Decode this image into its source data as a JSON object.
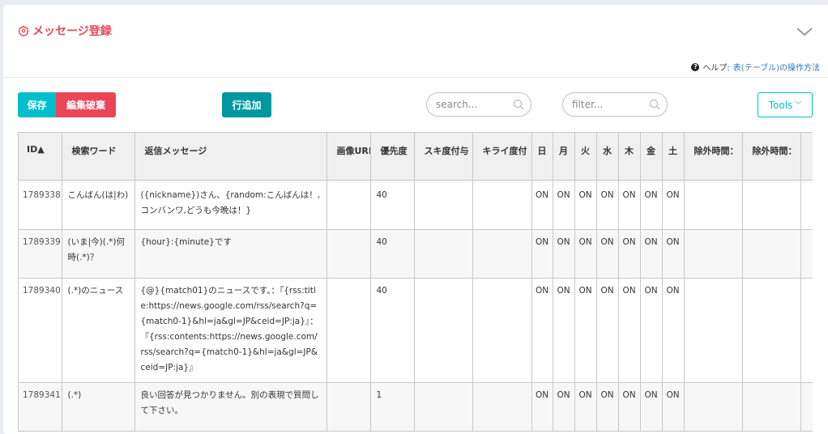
{
  "header": {
    "title": "メッセージ登録",
    "title_icon": "gear-icon",
    "collapse_icon": "chevron-down-icon",
    "help_label": "ヘルプ:",
    "help_link": "表(テーブル)の操作方法"
  },
  "toolbar": {
    "save": "保存",
    "discard": "編集破棄",
    "add_row": "行追加",
    "search_placeholder": "search...",
    "filter_placeholder": "filter...",
    "tools": "Tools"
  },
  "colors": {
    "accent": "#00bfcc",
    "danger": "#ea4658",
    "title": "#e8485a",
    "add": "#00979e"
  },
  "table": {
    "columns": [
      "ID▲",
      "検索ワード",
      "返信メッセージ",
      "画像URL",
      "優先度",
      "スキ度付与",
      "キライ度付",
      "日",
      "月",
      "火",
      "水",
      "木",
      "金",
      "土",
      "除外時間：",
      "除外時間：",
      ""
    ],
    "rows": [
      {
        "id": "1789338",
        "word": "こんばん(は|わ)",
        "reply": "({nickname})さん、{random:こんばんは！,コンバンワ,どうも今晩は！}",
        "image": "",
        "priority": "40",
        "like": "",
        "dislike": "",
        "days": [
          "ON",
          "ON",
          "ON",
          "ON",
          "ON",
          "ON",
          "ON"
        ]
      },
      {
        "id": "1789339",
        "word": "(いま|今)(.*)何時(.*)？",
        "reply": "{hour}:{minute}です",
        "image": "",
        "priority": "40",
        "like": "",
        "dislike": "",
        "days": [
          "ON",
          "ON",
          "ON",
          "ON",
          "ON",
          "ON",
          "ON"
        ]
      },
      {
        "id": "1789340",
        "word": "(.*)のニュース",
        "reply": "{@}{match01}のニュースです。：『{rss:title:https://news.google.com/rss/search?q={match0-1}&hl=ja&gl=JP&ceid=JP:ja}』：『{rss:contents:https://news.google.com/rss/search?q={match0-1}&hl=ja&gl=JP&ceid=JP:ja}』",
        "image": "",
        "priority": "40",
        "like": "",
        "dislike": "",
        "days": [
          "ON",
          "ON",
          "ON",
          "ON",
          "ON",
          "ON",
          "ON"
        ]
      },
      {
        "id": "1789341",
        "word": "(.*)",
        "reply": "良い回答が見つかりません。別の表現で質問して下さい。",
        "image": "",
        "priority": "1",
        "like": "",
        "dislike": "",
        "days": [
          "ON",
          "ON",
          "ON",
          "ON",
          "ON",
          "ON",
          "ON"
        ]
      }
    ]
  }
}
